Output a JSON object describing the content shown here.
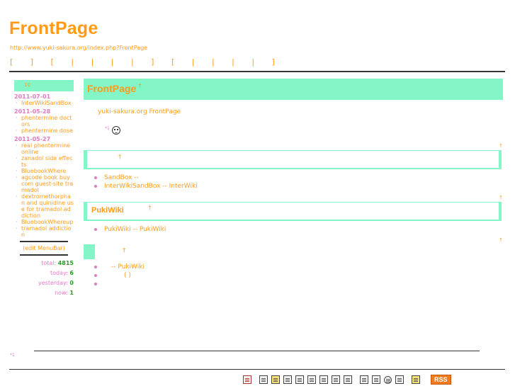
{
  "header": {
    "title": "FrontPage",
    "url": "http://www.yuki-sakura.org/index.php?FrontPage",
    "nav": "[ ] [ | | | | ] [ | | | | ]"
  },
  "sidebar": {
    "head": "10",
    "groups": [
      {
        "date": "2011-07-01",
        "items": [
          "InterWikiSandBox"
        ]
      },
      {
        "date": "2011-05-28",
        "items": [
          "phentermine doctors",
          "phentermine dose"
        ]
      },
      {
        "date": "2011-05-27",
        "items": [
          "real phentermine online",
          "zanadol side effects",
          "BluebookWhere",
          "agcode book buy com guest-site tramadol",
          "dextromethorphan and quinidine use for tramadol addiction",
          "BluebookWhereup",
          "tramadol addiction"
        ]
      }
    ],
    "edit_link": "(edit MenuBar)",
    "counter": [
      {
        "label": "total:",
        "value": "4815"
      },
      {
        "label": "today:",
        "value": "6"
      },
      {
        "label": "yesterday:",
        "value": "0"
      },
      {
        "label": "now:",
        "value": "1"
      }
    ]
  },
  "main": {
    "h1": "FrontPage",
    "h1_anchor": "†",
    "intro": "yuki-sakura.org FrontPage",
    "footnote_ref": "*1",
    "top_link": "↑",
    "section1": {
      "anchor": "†",
      "items": [
        "SandBox --",
        "InterWikiSandBox -- InterWiki"
      ]
    },
    "section2": {
      "title": "PukiWiki",
      "anchor": "†",
      "items": [
        "PukiWiki -- PukiWiki"
      ]
    },
    "section3": {
      "anchor": "†",
      "items": [
        "-- PukiWiki",
        "( )",
        ""
      ]
    }
  },
  "footer": {
    "footnote": "*1",
    "rss": "RSS"
  }
}
